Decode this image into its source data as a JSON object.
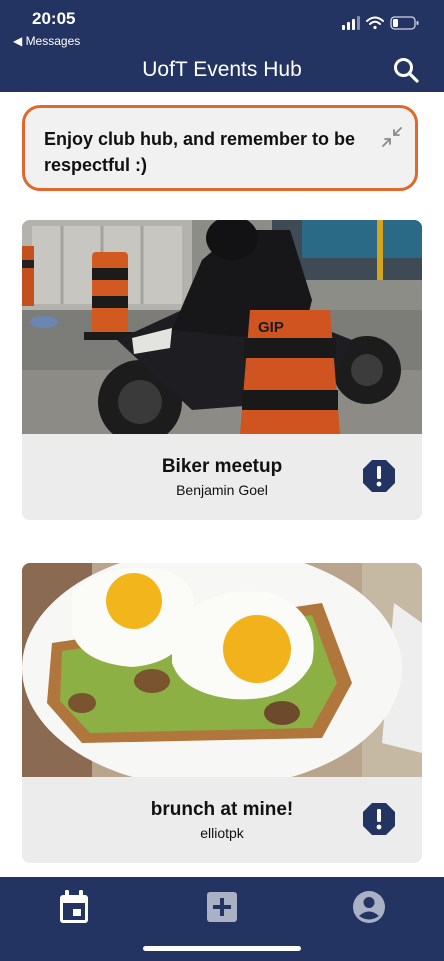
{
  "status_bar": {
    "time": "20:05",
    "back_label": "◀ Messages"
  },
  "header": {
    "title": "UofT Events Hub",
    "search_icon": "search-icon"
  },
  "banner": {
    "text": "Enjoy club hub, and remember to be respectful :)",
    "border_color": "#e0682c",
    "collapse_icon": "collapse-arrows-icon"
  },
  "events": [
    {
      "title": "Biker meetup",
      "author": "Benjamin Goel",
      "report_icon": "report-octagon-icon"
    },
    {
      "title": "brunch at mine!",
      "author": "elliotpk",
      "report_icon": "report-octagon-icon"
    }
  ],
  "bottom_nav": {
    "items": [
      {
        "icon": "calendar-icon",
        "active": true
      },
      {
        "icon": "add-square-icon",
        "active": false
      },
      {
        "icon": "account-circle-icon",
        "active": false
      }
    ]
  },
  "colors": {
    "brand_navy": "#243462",
    "accent_orange": "#e0682c",
    "card_gray": "#ececec"
  }
}
